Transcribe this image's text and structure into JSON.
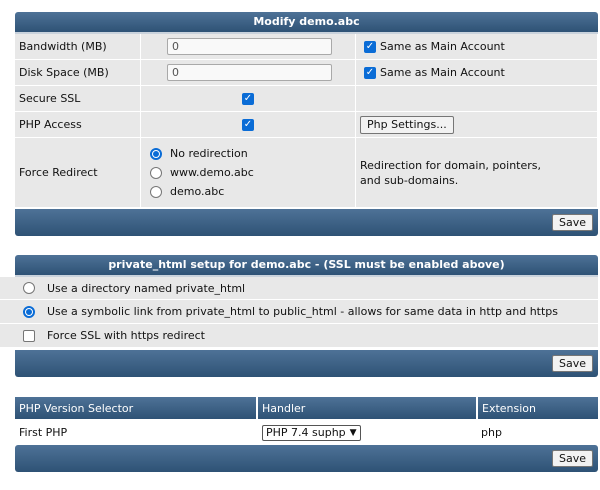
{
  "modify": {
    "title": "Modify demo.abc",
    "bandwidth": {
      "label": "Bandwidth (MB)",
      "value": "0",
      "same_label": "Same as Main Account",
      "same_checked": true
    },
    "disk": {
      "label": "Disk Space (MB)",
      "value": "0",
      "same_label": "Same as Main Account",
      "same_checked": true
    },
    "ssl": {
      "label": "Secure SSL",
      "checked": true
    },
    "php": {
      "label": "PHP Access",
      "checked": true,
      "settings_button": "Php Settings..."
    },
    "redirect": {
      "label": "Force Redirect",
      "options": [
        "No redirection",
        "www.demo.abc",
        "demo.abc"
      ],
      "selected": 0,
      "description_line1": "Redirection for domain, pointers,",
      "description_line2": "and sub-domains."
    },
    "save": "Save"
  },
  "private_html": {
    "title": "private_html setup for demo.abc - (SSL must be enabled above)",
    "option_dir": "Use a directory named private_html",
    "option_link": "Use a symbolic link from private_html to public_html - allows for same data in http and https",
    "selected": "link",
    "force_ssl": "Force SSL with https redirect",
    "force_ssl_checked": false,
    "save": "Save"
  },
  "php_versions": {
    "headers": {
      "selector": "PHP Version Selector",
      "handler": "Handler",
      "extension": "Extension"
    },
    "row": {
      "name": "First PHP",
      "handler": "PHP 7.4 suphp",
      "extension": "php"
    },
    "save": "Save"
  }
}
